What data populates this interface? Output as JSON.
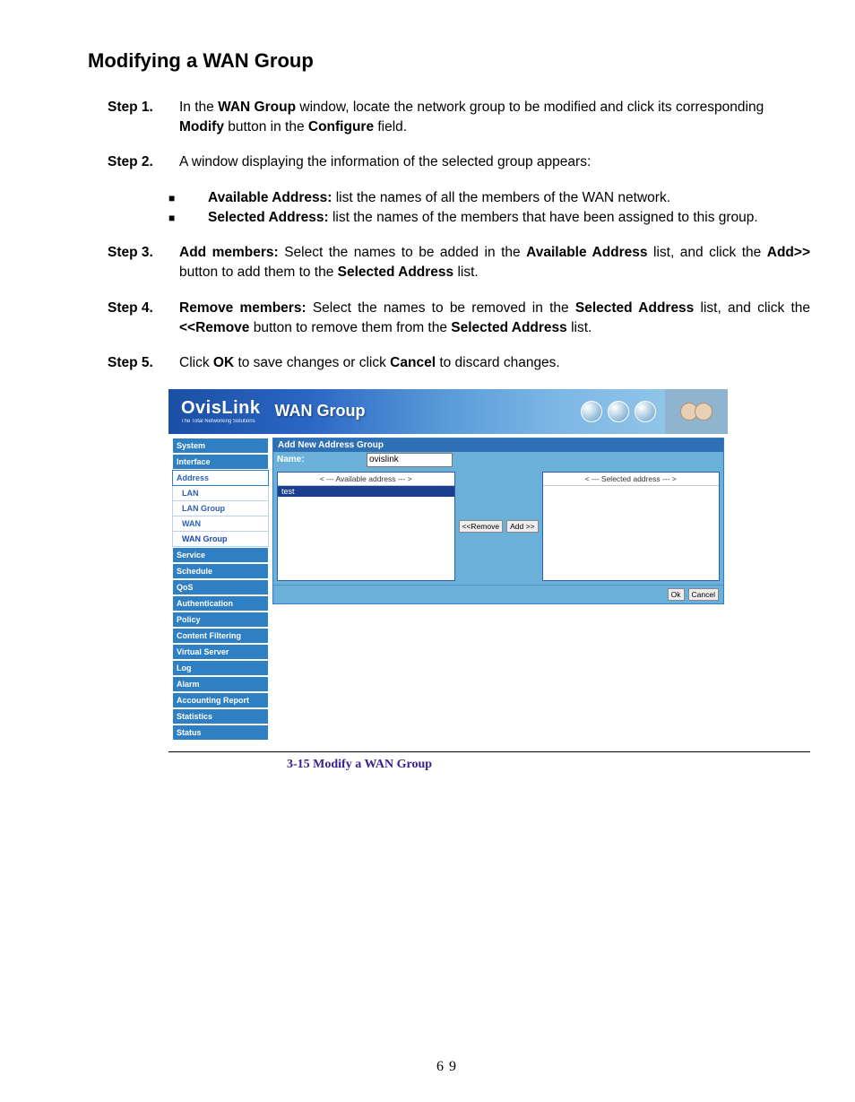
{
  "page_title": "Modifying a WAN Group",
  "steps": {
    "s1": {
      "label": "Step 1.",
      "pre": "In the ",
      "b1": "WAN Group",
      "mid1": " window, locate the network group to be modified and click its corresponding ",
      "b2": "Modify",
      "mid2": " button in the ",
      "b3": "Configure",
      "tail": " field."
    },
    "s2": {
      "label": "Step 2.",
      "text": "A window displaying the information of the selected group appears:"
    },
    "bul1": {
      "b": "Available Address:",
      "t": " list the names of all the members of the WAN   network."
    },
    "bul2": {
      "b": "Selected Address:",
      "t": " list the names of the members that have been assigned to this group."
    },
    "s3": {
      "label": "Step 3.",
      "b1": "Add members:",
      "mid1": " Select the names to be added in the ",
      "b2": "Available Address",
      "mid2": " list, and click the ",
      "b3": "Add>>",
      "mid3": " button to add them to the ",
      "b4": "Selected Address",
      "tail": " list."
    },
    "s4": {
      "label": "Step 4.",
      "b1": "Remove members:",
      "mid1": " Select the names to be removed in the ",
      "b2": "Selected Address",
      "mid2": " list, and click the ",
      "b3": "<<Remove",
      "mid3": " button to remove them from the ",
      "b4": "Selected Address",
      "tail": " list."
    },
    "s5": {
      "label": "Step 5.",
      "pre": "Click ",
      "b1": "OK",
      "mid1": " to save changes or click ",
      "b2": "Cancel",
      "tail": " to discard changes."
    }
  },
  "app": {
    "brand": "OvisLink",
    "brand_sub": "The Total Networking Solutions",
    "banner_title": "WAN Group",
    "sidebar": {
      "items": [
        "System",
        "Interface",
        "Address",
        "Service",
        "Schedule",
        "QoS",
        "Authentication",
        "Policy",
        "Content Filtering",
        "Virtual Server",
        "Log",
        "Alarm",
        "Accounting Report",
        "Statistics",
        "Status"
      ],
      "subs": [
        "LAN",
        "LAN Group",
        "WAN",
        "WAN Group"
      ]
    },
    "panel": {
      "header": "Add New Address Group",
      "name_label": "Name:",
      "name_value": "ovislink",
      "avail_head": "< --- Available address --- >",
      "avail_item": "test",
      "sel_head": "< --- Selected address --- >",
      "btn_remove": "<<Remove",
      "btn_add": "Add  >>",
      "btn_ok": "Ok",
      "btn_cancel": "Cancel"
    }
  },
  "figure_caption": "3-15 Modify a WAN Group",
  "page_number": "69"
}
